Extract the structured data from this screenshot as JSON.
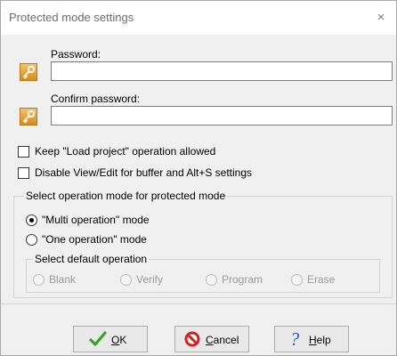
{
  "window": {
    "title": "Protected mode settings",
    "close_glyph": "×"
  },
  "password": {
    "label": "Password:",
    "value": ""
  },
  "confirm": {
    "label": "Confirm password:",
    "value": ""
  },
  "options": {
    "keep_load": "Keep \"Load project\" operation allowed",
    "disable_view": "Disable View/Edit for buffer and Alt+S settings"
  },
  "mode_group": {
    "title": "Select operation mode for protected mode",
    "multi": "\"Multi operation\" mode",
    "one": "\"One operation\" mode",
    "selected": "multi"
  },
  "default_group": {
    "title": "Select default operation",
    "items": [
      "Blank",
      "Verify",
      "Program",
      "Erase"
    ]
  },
  "buttons": {
    "ok": {
      "underline": "O",
      "rest": "K"
    },
    "cancel": {
      "underline": "C",
      "rest": "ancel"
    },
    "help": {
      "underline": "H",
      "rest": "elp"
    }
  },
  "icons": {
    "key": "key-icon",
    "ok": "checkmark-icon",
    "cancel": "no-entry-icon",
    "help": "question-mark-icon"
  },
  "colors": {
    "key_icon": "#e7a53a",
    "ok_check": "#3aa12a",
    "cancel_red": "#d42020",
    "help_blue": "#2b5fb3"
  }
}
